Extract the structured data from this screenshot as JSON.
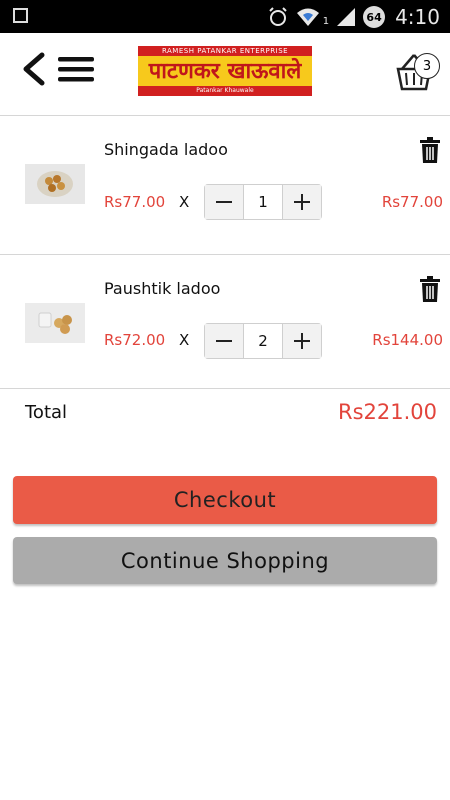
{
  "status_bar": {
    "time": "4:10",
    "battery": "64",
    "signal_sub": "1"
  },
  "header": {
    "logo": {
      "top_text": "RAMESH PATANKAR ENTERPRISE",
      "main_text": "पाटणकर खाऊवाले",
      "bottom_text": "Patankar Khauwale"
    },
    "cart_count": "3"
  },
  "cart_items": [
    {
      "name": "Shingada ladoo",
      "price": "Rs77.00",
      "times": "X",
      "quantity": "1",
      "subtotal": "Rs77.00",
      "minus": "−",
      "plus": "+"
    },
    {
      "name": "Paushtik ladoo",
      "price": "Rs72.00",
      "times": "X",
      "quantity": "2",
      "subtotal": "Rs144.00",
      "minus": "−",
      "plus": "+"
    }
  ],
  "summary": {
    "total_label": "Total",
    "total_value": "Rs221.00"
  },
  "actions": {
    "checkout_label": "Checkout",
    "continue_label": "Continue Shopping"
  },
  "colors": {
    "accent": "#e2443b",
    "checkout_bg": "#ea5b47",
    "continue_bg": "#ababab",
    "logo_yellow": "#f7c91c",
    "logo_red": "#c0161b"
  },
  "icons": [
    "back-icon",
    "menu-icon",
    "cart-icon",
    "trash-icon",
    "minus-icon",
    "plus-icon",
    "wifi-icon",
    "alarm-icon"
  ]
}
